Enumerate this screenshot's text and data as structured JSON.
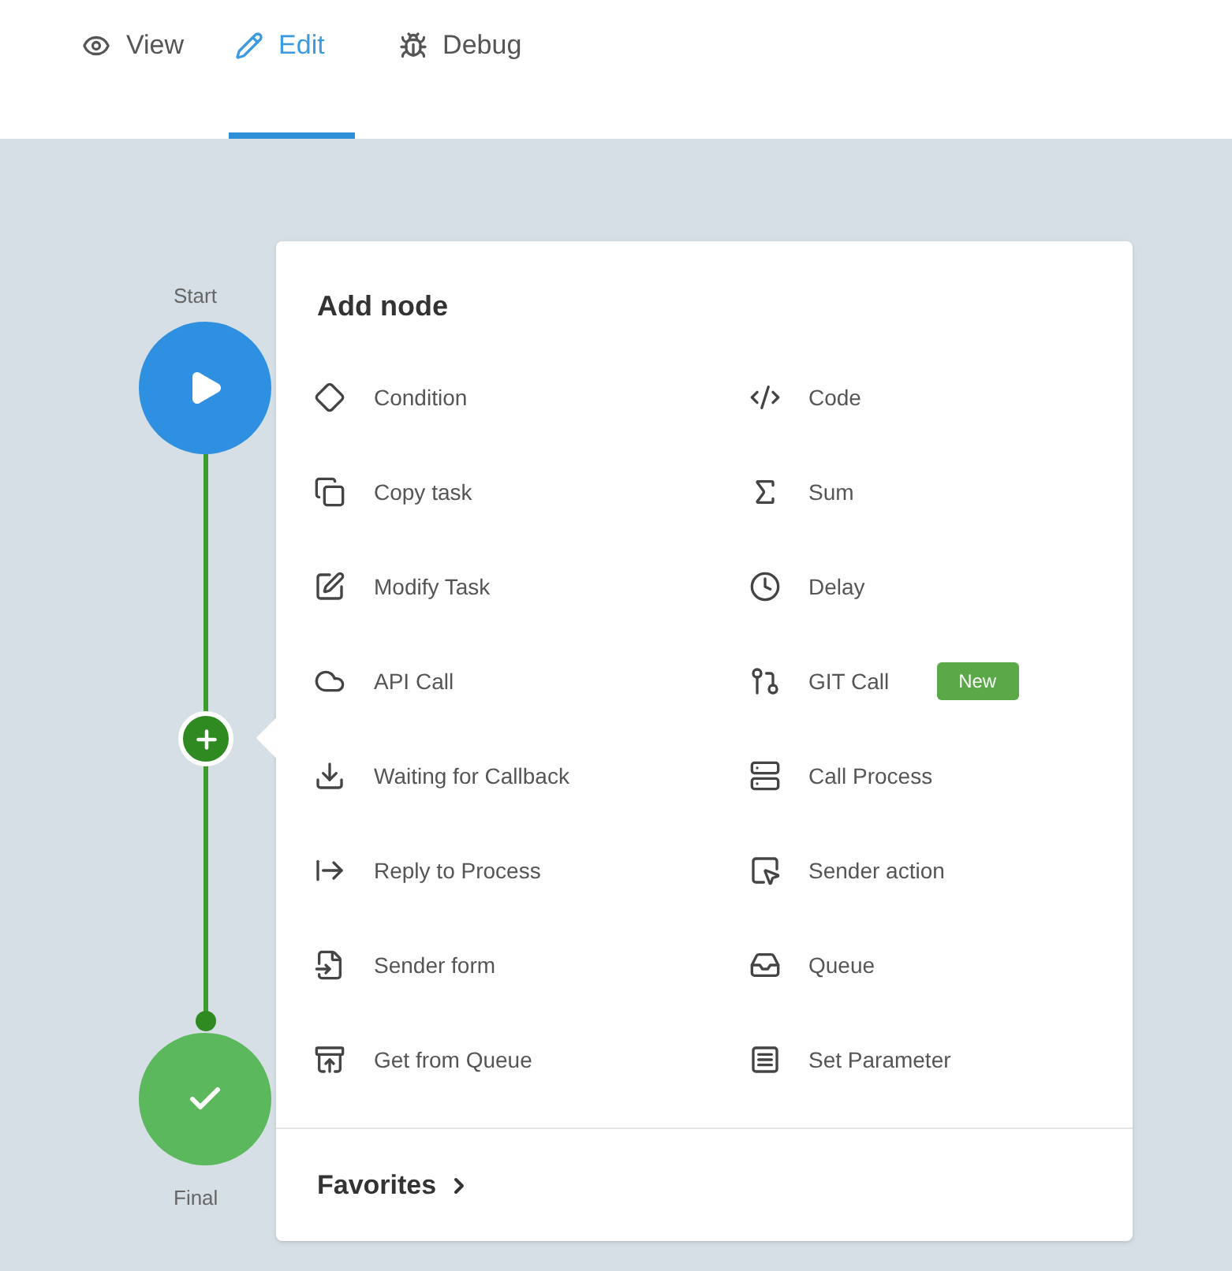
{
  "tabs": [
    {
      "label": "View",
      "selected": false
    },
    {
      "label": "Edit",
      "selected": true
    },
    {
      "label": "Debug",
      "selected": false
    }
  ],
  "flow": {
    "start_label": "Start",
    "final_label": "Final"
  },
  "menu": {
    "title": "Add node",
    "items": [
      {
        "label": "Condition"
      },
      {
        "label": "Code"
      },
      {
        "label": "Copy task"
      },
      {
        "label": "Sum"
      },
      {
        "label": "Modify Task"
      },
      {
        "label": "Delay"
      },
      {
        "label": "API Call"
      },
      {
        "label": "GIT Call",
        "badge": "New"
      },
      {
        "label": "Waiting for Callback"
      },
      {
        "label": "Call Process"
      },
      {
        "label": "Reply to Process"
      },
      {
        "label": "Sender action"
      },
      {
        "label": "Sender form"
      },
      {
        "label": "Queue"
      },
      {
        "label": "Get from Queue"
      },
      {
        "label": "Set Parameter"
      }
    ],
    "favorites": "Favorites"
  }
}
